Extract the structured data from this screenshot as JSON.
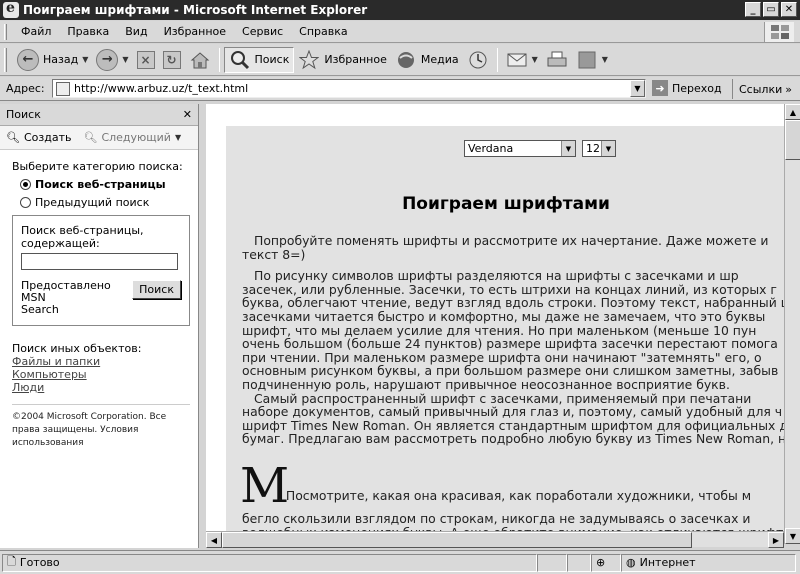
{
  "window": {
    "title": "Поиграем шрифтами - Microsoft Internet Explorer",
    "controls": [
      "_",
      "▭",
      "✕"
    ]
  },
  "menubar": {
    "items": [
      {
        "label": "Файл"
      },
      {
        "label": "Правка"
      },
      {
        "label": "Вид"
      },
      {
        "label": "Избранное"
      },
      {
        "label": "Сервис"
      },
      {
        "label": "Справка"
      }
    ]
  },
  "toolbar": {
    "back": "Назад",
    "search": "Поиск",
    "favorites": "Избранное",
    "media": "Медиа"
  },
  "address": {
    "label": "Адрес:",
    "url": "http://www.arbuz.uz/t_text.html",
    "go": "Переход",
    "links": "Ссылки"
  },
  "sidebar": {
    "title": "Поиск",
    "create": "Создать",
    "next": "Следующий",
    "category_prompt": "Выберите категорию поиска:",
    "options": [
      "Поиск веб-страницы",
      "Предыдущий поиск"
    ],
    "box_label_1": "Поиск веб-страницы,",
    "box_label_2": "содержащей:",
    "query": "",
    "provider_1": "Предоставлено MSN",
    "provider_2": "Search",
    "search_button": "Поиск",
    "other_title": "Поиск иных объектов:",
    "other_links": [
      "Файлы и папки",
      "Компьютеры",
      "Люди"
    ],
    "copyright_1": "©2004 Microsoft Corporation. Все",
    "copyright_2": "права защищены.      Условия",
    "copyright_3": "использования"
  },
  "page": {
    "font_select": "Verdana",
    "size_select": "12",
    "heading": "Поиграем шрифтами",
    "p1": [
      "Попробуйте поменять шрифты и рассмотрите их начертание. Даже можете и",
      "текст 8=)"
    ],
    "p2": [
      "По рисунку символов шрифты разделяются на шрифты с засечками и шр",
      "засечек, или рубленные. Засечки, то есть штрихи на концах линий, из которых г",
      "буква, облегчают чтение, ведут взгляд вдоль строки. Поэтому текст, набранный ш",
      "засечками читается быстро и комфортно, мы даже не замечаем, что это буквы",
      "шрифт, что мы делаем усилие для чтения. Но при маленьком (меньше 10 пун",
      "очень большом (больше 24 пунктов) размере шрифта засечки перестают помога",
      "при чтении. При маленьком размере шрифта они начинают \"затемнять\" его, о",
      "основным рисунком буквы, а при большом размере они слишком заметны, забыв",
      "подчиненную роль, нарушают привычное неосознанное восприятие букв."
    ],
    "p3": [
      "Самый распространенный шрифт с засечками, применяемый при печатани",
      "наборе документов, самый привычный для глаз и, поэтому, самый удобный для ч",
      "шрифт Times New Roman. Он является стандартным шрифтом для официальных д",
      "бумаг. Предлагаю вам рассмотреть подробно любую букву из Times New Roman, н"
    ],
    "dropcap": "M",
    "dropline": ". Посмотрите, какая она красивая, как поработали художники, чтобы м",
    "tail": [
      "бегло скользили взглядом по строкам, никогда не задумываясь о засечках и",
      "волшебных изменениях буквы. А еще обратите внимание, как отличаются шрифты"
    ]
  },
  "status": {
    "text": "Готово",
    "zone": "Интернет"
  }
}
